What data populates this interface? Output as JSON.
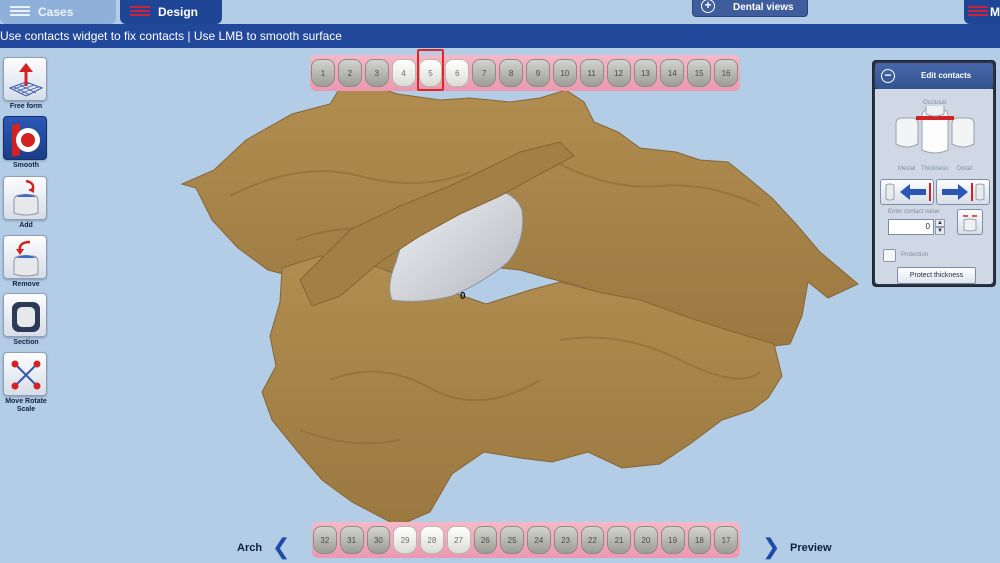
{
  "tabs": {
    "cases": "Cases",
    "design": "Design",
    "dental_views": "Dental views",
    "menu": "Me"
  },
  "instruction": "Use contacts widget to fix contacts | Use LMB to smooth surface",
  "tools": [
    {
      "label": "Free form",
      "icon": "free-form-icon"
    },
    {
      "label": "Smooth",
      "icon": "smooth-icon"
    },
    {
      "label": "Add",
      "icon": "add-material-icon"
    },
    {
      "label": "Remove",
      "icon": "remove-material-icon"
    },
    {
      "label": "Section",
      "icon": "section-icon"
    },
    {
      "label": "Move Rotate Scale",
      "icon": "move-rotate-scale-icon"
    }
  ],
  "upper_teeth": [
    "1",
    "2",
    "3",
    "4",
    "5",
    "6",
    "7",
    "8",
    "9",
    "10",
    "11",
    "12",
    "13",
    "14",
    "15",
    "16"
  ],
  "lower_teeth": [
    "32",
    "31",
    "30",
    "29",
    "28",
    "27",
    "26",
    "25",
    "24",
    "23",
    "22",
    "21",
    "20",
    "19",
    "18",
    "17"
  ],
  "selected_tooth": "5",
  "nav": {
    "arch": "Arch",
    "preview": "Preview"
  },
  "panel": {
    "title": "Edit contacts",
    "occlusal": "Occlusal",
    "mesial": "Mesial",
    "thickness": "Thickness",
    "distal": "Distal",
    "enter_contact_value": "Enter contact value",
    "contact_value": "0",
    "protection": "Protection",
    "protect_thickness": "Protect thickness"
  },
  "contact_marker": "0",
  "colors": {
    "background": "#b4cde6",
    "header_blue": "#21489a",
    "model_gold": "#a8854a",
    "crown_grey": "#d2d6dc",
    "gum_pink": "#ec98b1"
  }
}
